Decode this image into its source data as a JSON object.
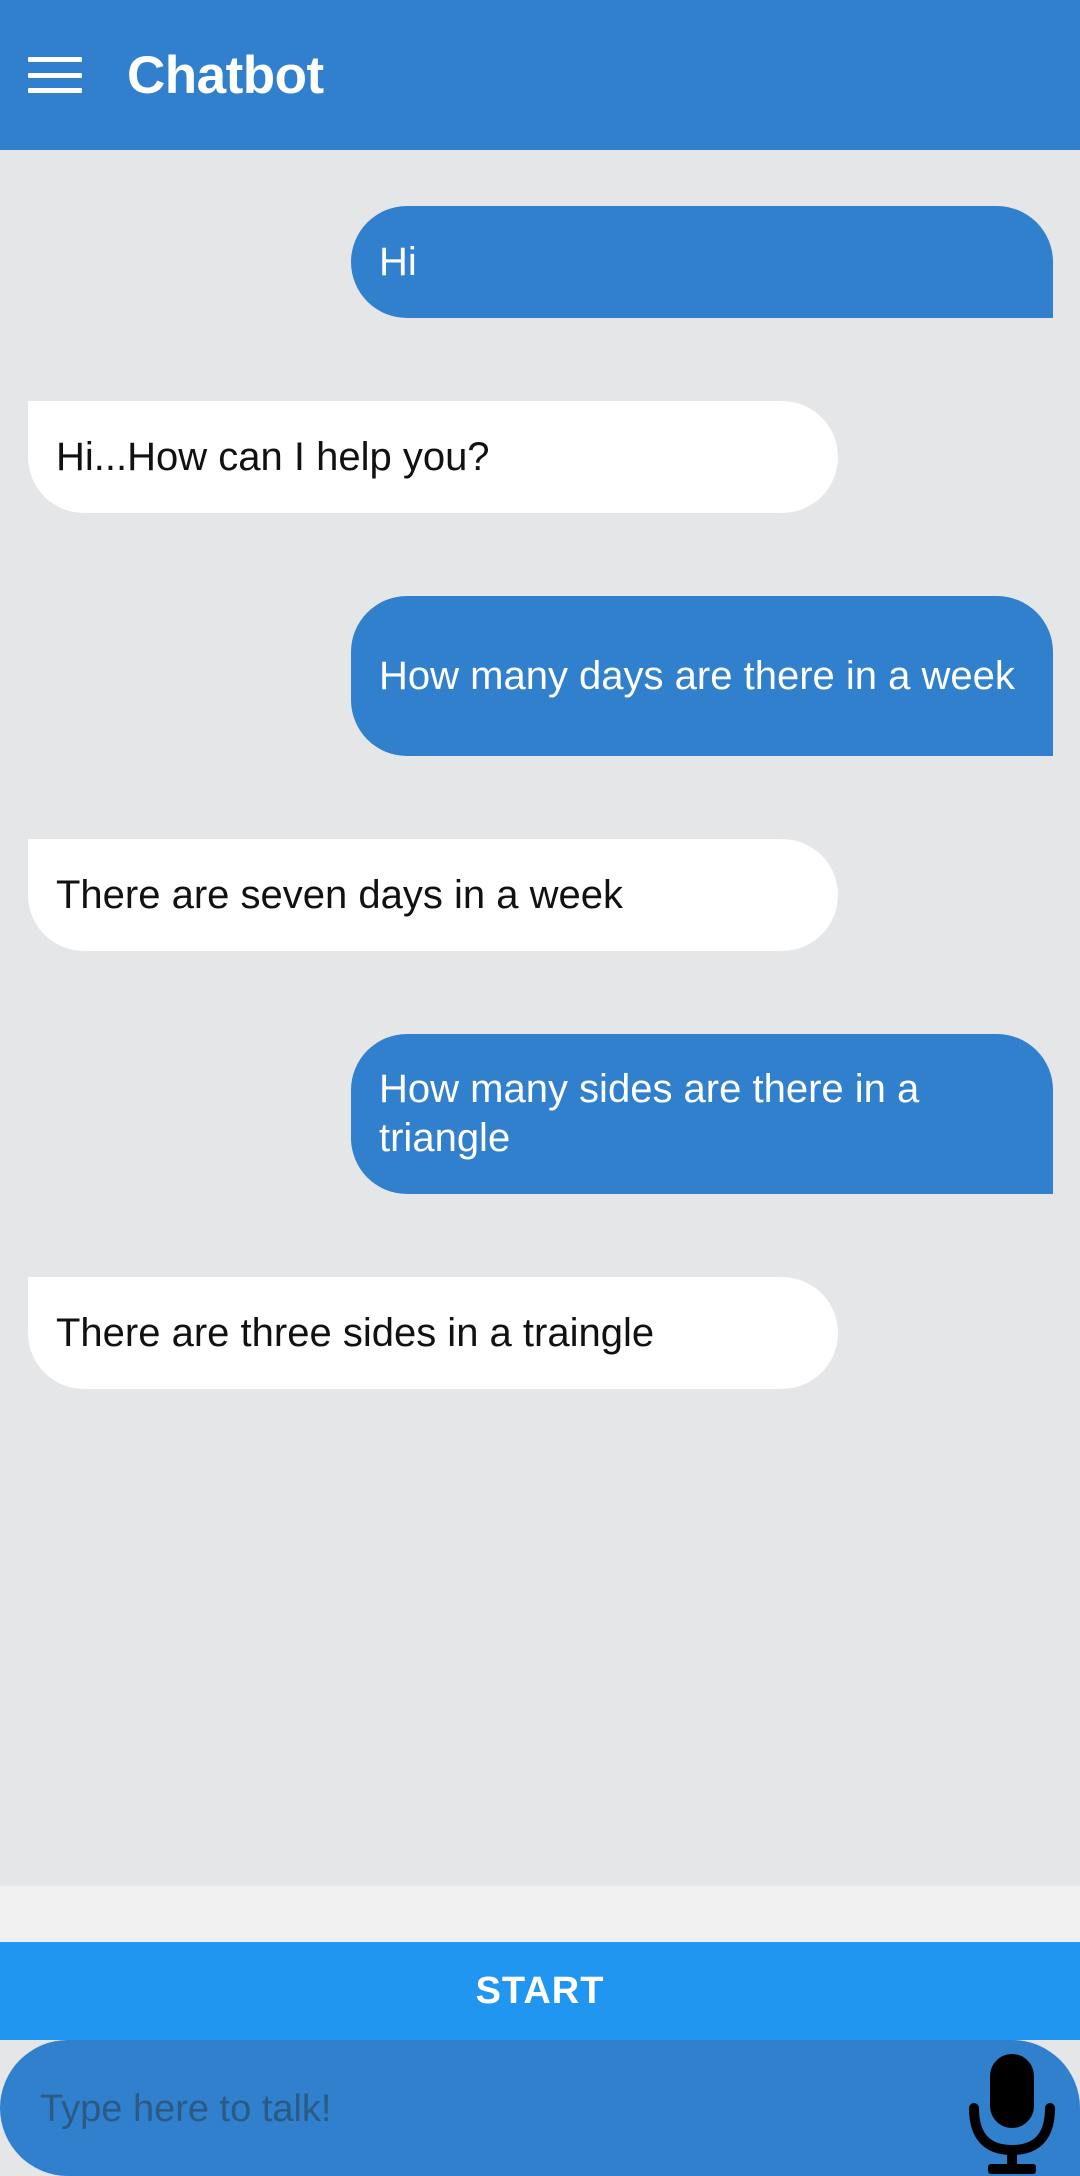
{
  "appbar": {
    "title": "Chatbot",
    "menu_icon": "hamburger-menu-icon"
  },
  "messages": [
    {
      "sender": "user",
      "text": "Hi"
    },
    {
      "sender": "bot",
      "text": "Hi...How can I help you?"
    },
    {
      "sender": "user",
      "text": "How many days are there in a week"
    },
    {
      "sender": "bot",
      "text": "There are seven days in a week"
    },
    {
      "sender": "user",
      "text": "How many sides are there in a triangle"
    },
    {
      "sender": "bot",
      "text": "There are three sides in a traingle"
    }
  ],
  "controls": {
    "start_label": "START",
    "input_placeholder": "Type here to talk!",
    "mic_icon": "microphone-icon"
  },
  "colors": {
    "primary": "#3180cd",
    "button": "#2196f0",
    "background": "#e5e6e8",
    "bot_bubble": "#ffffff"
  }
}
